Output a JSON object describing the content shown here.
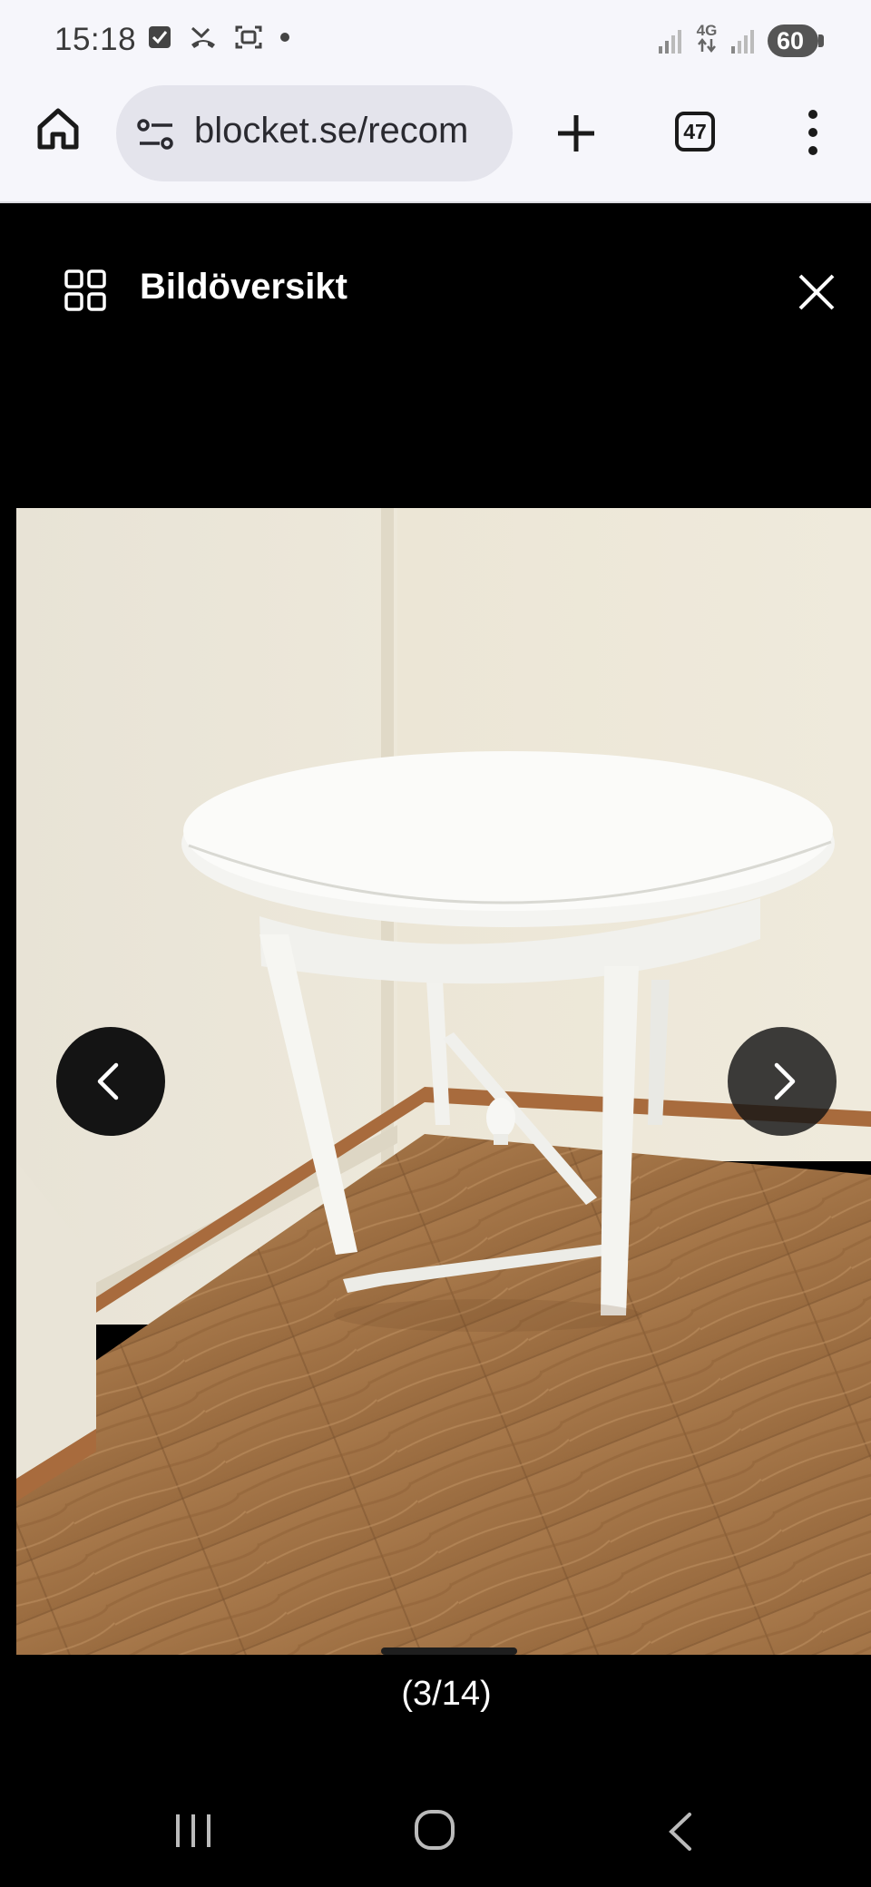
{
  "status_bar": {
    "time": "15:18",
    "left_icons": [
      "checkbox-icon",
      "missed-call-icon",
      "screenshot-icon",
      "dot-icon"
    ],
    "network_label": "4G",
    "battery": "60"
  },
  "browser": {
    "url": "blocket.se/recom",
    "tab_count": "47"
  },
  "gallery": {
    "title": "Bildöversikt",
    "counter": "(3/14)"
  },
  "colors": {
    "chrome_bg": "#f6f6fb",
    "url_pill": "#e4e4ec",
    "overlay_bg": "#000000"
  }
}
